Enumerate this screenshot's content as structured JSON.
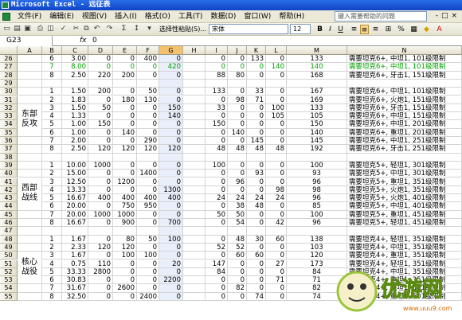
{
  "window": {
    "title": "Microsoft Excel - 远征表"
  },
  "menu": [
    "文件(F)",
    "编辑(E)",
    "视图(V)",
    "插入(I)",
    "格式(O)",
    "工具(T)",
    "数据(D)",
    "窗口(W)",
    "帮助(H)"
  ],
  "help_placeholder": "键入需要帮助的问题",
  "toolbar": {
    "paste_label": "选择性粘贴(S)...",
    "font": "宋体",
    "size": "12"
  },
  "formula": {
    "name_box": "G23",
    "fx": "fx",
    "value": "0"
  },
  "columns": [
    "A",
    "B",
    "C",
    "D",
    "E",
    "F",
    "G",
    "H",
    "I",
    "J",
    "K",
    "L",
    "M",
    "N"
  ],
  "selected_column": "G",
  "groups": [
    {
      "label": "东部反攻"
    },
    {
      "label": "西部战线"
    },
    {
      "label": "核心战役"
    }
  ],
  "rows": [
    {
      "n": "26",
      "b": "6",
      "c": "3.00",
      "d": "0",
      "e": "0",
      "f": "400",
      "g": "0",
      "i": "0",
      "j": "0",
      "k": "133",
      "l": "0",
      "m": "133",
      "note": "需要坦克6+, 中坦1, 101级限制"
    },
    {
      "n": "27",
      "b": "7",
      "c": "8.00",
      "d": "0",
      "e": "0",
      "f": "0",
      "g": "420",
      "i": "0",
      "j": "0",
      "k": "0",
      "l": "140",
      "m": "140",
      "note": "需要坦克6+, 中坦1, 101级限制",
      "green": true
    },
    {
      "n": "28",
      "b": "8",
      "c": "2.50",
      "d": "220",
      "e": "200",
      "f": "0",
      "g": "0",
      "i": "88",
      "j": "80",
      "k": "0",
      "l": "0",
      "m": "168",
      "note": "需要坦克6+, 牙击1, 151级限制"
    },
    {
      "n": "29"
    },
    {
      "n": "30",
      "b": "1",
      "c": "1.50",
      "d": "200",
      "e": "0",
      "f": "50",
      "g": "0",
      "i": "133",
      "j": "0",
      "k": "33",
      "l": "0",
      "m": "167",
      "note": "需要坦克6+, 中坦1, 101级限制"
    },
    {
      "n": "31",
      "b": "2",
      "c": "1.83",
      "d": "0",
      "e": "180",
      "f": "130",
      "g": "0",
      "i": "0",
      "j": "98",
      "k": "71",
      "l": "0",
      "m": "169",
      "note": "需要坦克6+, 火炮1, 151级限制"
    },
    {
      "n": "32",
      "b": "3",
      "c": "1.50",
      "d": "50",
      "e": "0",
      "f": "0",
      "g": "150",
      "i": "33",
      "j": "0",
      "k": "0",
      "l": "100",
      "m": "133",
      "note": "需要坦克6+, 牙击1, 151级限制"
    },
    {
      "n": "33",
      "b": "4",
      "c": "1.33",
      "d": "0",
      "e": "0",
      "f": "0",
      "g": "140",
      "i": "0",
      "j": "0",
      "k": "0",
      "l": "105",
      "m": "105",
      "note": "需要坦克6+, 中坦1, 151级限制"
    },
    {
      "n": "34",
      "b": "5",
      "c": "1.00",
      "d": "150",
      "e": "0",
      "f": "0",
      "g": "0",
      "i": "150",
      "j": "0",
      "k": "0",
      "l": "0",
      "m": "150",
      "note": "需要坦克6+, 中坦1, 201级限制"
    },
    {
      "n": "35",
      "b": "6",
      "c": "1.00",
      "d": "0",
      "e": "140",
      "f": "0",
      "g": "0",
      "i": "0",
      "j": "140",
      "k": "0",
      "l": "0",
      "m": "140",
      "note": "需要坦克6+, 重坦1, 201级限制"
    },
    {
      "n": "36",
      "b": "7",
      "c": "2.00",
      "d": "0",
      "e": "0",
      "f": "290",
      "g": "0",
      "i": "0",
      "j": "0",
      "k": "145",
      "l": "0",
      "m": "145",
      "note": "需要坦克6+, 中坦1, 251级限制"
    },
    {
      "n": "37",
      "b": "8",
      "c": "2.50",
      "d": "120",
      "e": "120",
      "f": "120",
      "g": "120",
      "i": "48",
      "j": "48",
      "k": "48",
      "l": "48",
      "m": "192",
      "note": "需要坦克6+, 牙击1, 251级限制"
    },
    {
      "n": "38"
    },
    {
      "n": "39",
      "b": "1",
      "c": "10.00",
      "d": "1000",
      "e": "0",
      "f": "0",
      "g": "0",
      "i": "100",
      "j": "0",
      "k": "0",
      "l": "0",
      "m": "100",
      "note": "需要坦克5+, 轻坦1, 301级限制"
    },
    {
      "n": "40",
      "b": "2",
      "c": "15.00",
      "d": "0",
      "e": "0",
      "f": "1400",
      "g": "0",
      "i": "0",
      "j": "0",
      "k": "93",
      "l": "0",
      "m": "93",
      "note": "需要坦克5+, 中坦1, 301级限制"
    },
    {
      "n": "41",
      "b": "3",
      "c": "12.50",
      "d": "0",
      "e": "1200",
      "f": "0",
      "g": "0",
      "i": "0",
      "j": "96",
      "k": "0",
      "l": "0",
      "m": "96",
      "note": "需要坦克5+, 重坦1, 351级限制"
    },
    {
      "n": "42",
      "b": "4",
      "c": "13.33",
      "d": "0",
      "e": "0",
      "f": "0",
      "g": "1300",
      "i": "0",
      "j": "0",
      "k": "0",
      "l": "98",
      "m": "98",
      "note": "需要坦克5+, 火炮1, 351级限制"
    },
    {
      "n": "43",
      "b": "5",
      "c": "16.67",
      "d": "400",
      "e": "400",
      "f": "400",
      "g": "400",
      "i": "24",
      "j": "24",
      "k": "24",
      "l": "24",
      "m": "96",
      "note": "需要坦克5+, 火炮1, 401级限制"
    },
    {
      "n": "44",
      "b": "6",
      "c": "20.00",
      "d": "0",
      "e": "750",
      "f": "950",
      "g": "0",
      "i": "0",
      "j": "38",
      "k": "48",
      "l": "0",
      "m": "85",
      "note": "需要坦克5+, 中坦1, 401级限制"
    },
    {
      "n": "45",
      "b": "7",
      "c": "20.00",
      "d": "1000",
      "e": "1000",
      "f": "0",
      "g": "0",
      "i": "50",
      "j": "50",
      "k": "0",
      "l": "0",
      "m": "100",
      "note": "需要坦克5+, 重坦1, 451级限制"
    },
    {
      "n": "46",
      "b": "8",
      "c": "16.67",
      "d": "0",
      "e": "900",
      "f": "0",
      "g": "700",
      "i": "0",
      "j": "54",
      "k": "0",
      "l": "42",
      "m": "96",
      "note": "需要坦克5+, 轻坦1, 451级限制"
    },
    {
      "n": "47"
    },
    {
      "n": "48",
      "b": "1",
      "c": "1.67",
      "d": "0",
      "e": "80",
      "f": "50",
      "g": "100",
      "i": "0",
      "j": "48",
      "k": "30",
      "l": "60",
      "m": "138",
      "note": "需要坦克4+, 轻坦1, 351级限制"
    },
    {
      "n": "49",
      "b": "2",
      "c": "2.33",
      "d": "120",
      "e": "120",
      "f": "0",
      "g": "0",
      "i": "52",
      "j": "52",
      "k": "0",
      "l": "0",
      "m": "103",
      "note": "需要坦克4+, 中坦1, 351级限制"
    },
    {
      "n": "50",
      "b": "3",
      "c": "1.67",
      "d": "0",
      "e": "100",
      "f": "100",
      "g": "0",
      "i": "0",
      "j": "60",
      "k": "60",
      "l": "0",
      "m": "120",
      "note": "需要坦克4+, 重坦1, 351级限制"
    },
    {
      "n": "51",
      "b": "4",
      "c": "0.75",
      "d": "110",
      "e": "0",
      "f": "0",
      "g": "20",
      "i": "147",
      "j": "0",
      "k": "0",
      "l": "27",
      "m": "173",
      "note": "需要坦克4+, 轻坦1, 351级限制"
    },
    {
      "n": "52",
      "b": "5",
      "c": "33.33",
      "d": "2800",
      "e": "0",
      "f": "0",
      "g": "0",
      "i": "84",
      "j": "0",
      "k": "0",
      "l": "0",
      "m": "84",
      "note": "需要坦克4+, 中坦1, 351级限制"
    },
    {
      "n": "53",
      "b": "6",
      "c": "30.83",
      "d": "0",
      "e": "0",
      "f": "0",
      "g": "2200",
      "i": "0",
      "j": "0",
      "k": "0",
      "l": "71",
      "m": "71",
      "note": "需要坦克4+, 重坦1, 351级限制"
    },
    {
      "n": "54",
      "b": "7",
      "c": "31.67",
      "d": "0",
      "e": "2600",
      "f": "0",
      "g": "0",
      "i": "0",
      "j": "82",
      "k": "0",
      "l": "0",
      "m": "82",
      "note": "需要坦克4+, 轻坦1, 501级限制"
    },
    {
      "n": "55",
      "b": "8",
      "c": "32.50",
      "d": "0",
      "e": "0",
      "f": "2400",
      "g": "0",
      "i": "0",
      "j": "0",
      "k": "74",
      "l": "0",
      "m": "74",
      "note": "需要坦克4+, 重坦1, 501级限制"
    }
  ],
  "watermark": {
    "text": "优游网",
    "url": "www.uuu9.com"
  }
}
